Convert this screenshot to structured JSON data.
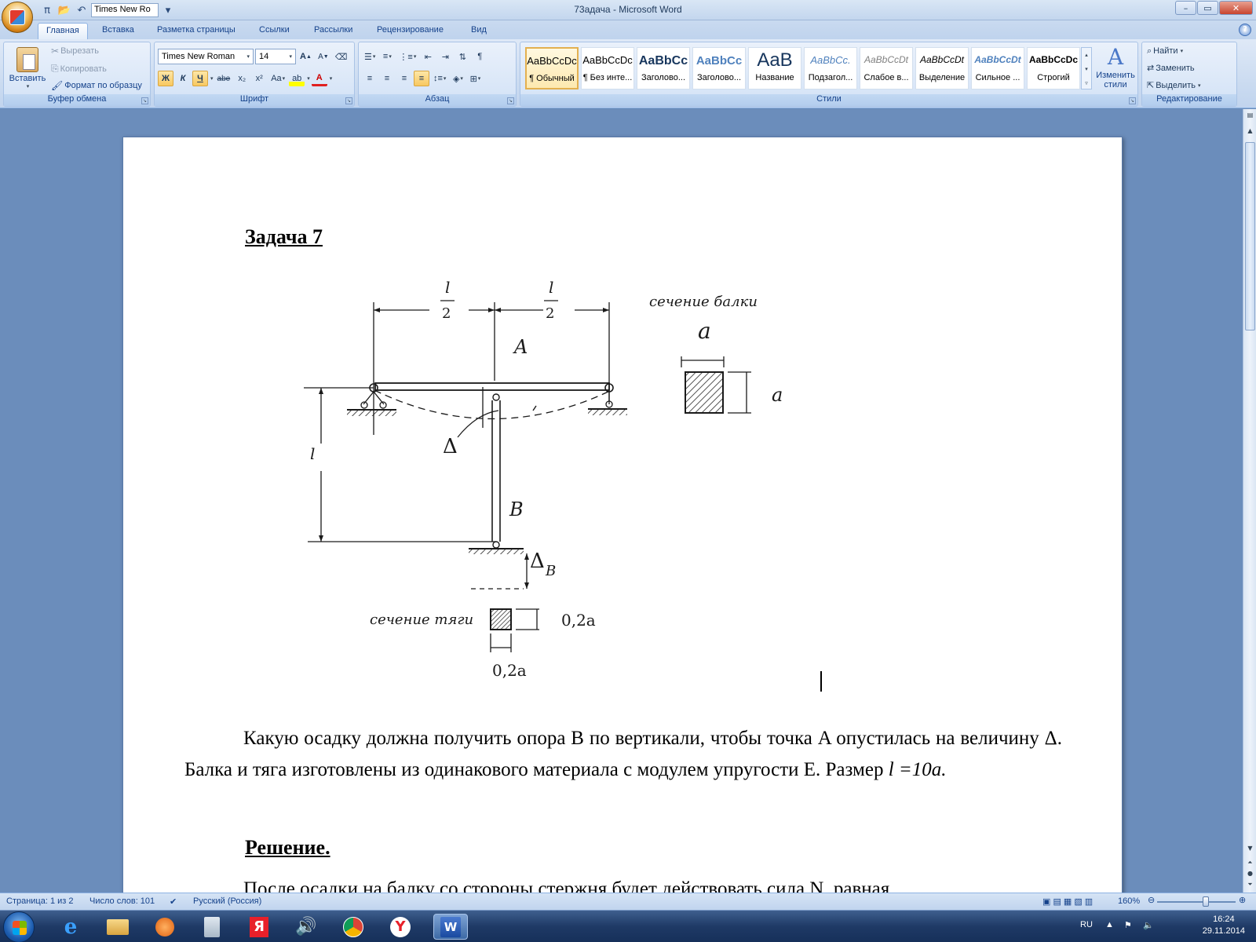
{
  "window": {
    "title": "73адача - Microsoft Word",
    "qat_font": "Times New Ro",
    "min": "–",
    "max": "▭",
    "close": "✕"
  },
  "tabs": [
    "Главная",
    "Вставка",
    "Разметка страницы",
    "Ссылки",
    "Рассылки",
    "Рецензирование",
    "Вид"
  ],
  "ribbon": {
    "clipboard": {
      "label": "Буфер обмена",
      "paste": "Вставить",
      "cut": "Вырезать",
      "copy": "Копировать",
      "format_painter": "Формат по образцу"
    },
    "font": {
      "label": "Шрифт",
      "family": "Times New Roman",
      "size": "14",
      "bold": "Ж",
      "italic": "К",
      "underline": "Ч",
      "strike": "abe",
      "sub": "x₂",
      "sup": "x²",
      "case": "Aa",
      "grow": "A",
      "shrink": "A"
    },
    "paragraph": {
      "label": "Абзац"
    },
    "styles": {
      "label": "Стили",
      "change": "Изменить стили",
      "items": [
        {
          "sample": "AaBbCcDc",
          "name": "¶ Обычный"
        },
        {
          "sample": "AaBbCcDc",
          "name": "¶ Без инте..."
        },
        {
          "sample": "AaBbCc",
          "name": "Заголово..."
        },
        {
          "sample": "AaBbCc",
          "name": "Заголово..."
        },
        {
          "sample": "AaB",
          "name": "Название"
        },
        {
          "sample": "AaBbCc.",
          "name": "Подзагол..."
        },
        {
          "sample": "AaBbCcDt",
          "name": "Слабое в..."
        },
        {
          "sample": "AaBbCcDt",
          "name": "Выделение"
        },
        {
          "sample": "AaBbCcDt",
          "name": "Сильное ..."
        },
        {
          "sample": "AaBbCcDc",
          "name": "Строгий"
        }
      ]
    },
    "editing": {
      "label": "Редактирование",
      "find": "Найти",
      "replace": "Заменить",
      "select": "Выделить"
    }
  },
  "document": {
    "heading1": "Задача 7",
    "paragraph1": "Какую осадку должна получить опора B по вертикали, чтобы точка   A опустилась на величину   Δ. Балка и тяга изготовлены из одинакового материала с модулем упругости  E. Размер ",
    "paragraph1_formula": "l =10a.",
    "heading2": "Решение.",
    "paragraph2": "После осадки на балку со стороны стержня будет действовать сила N,  равная",
    "figure": {
      "l": "l",
      "two": "2",
      "label_A": "A",
      "label_B": "B",
      "delta": "Δ",
      "delta_B": "Δ",
      "delta_B_sub": "B",
      "beam_section": "сечение балки",
      "rod_section": "сечение тяги",
      "a": "a",
      "rod_dim": "0,2a"
    }
  },
  "status": {
    "page": "Страница: 1 из 2",
    "words": "Число слов: 101",
    "language": "Русский (Россия)",
    "zoom": "160%"
  },
  "taskbar": {
    "lang": "RU",
    "time": "16:24",
    "date": "29.11.2014"
  }
}
